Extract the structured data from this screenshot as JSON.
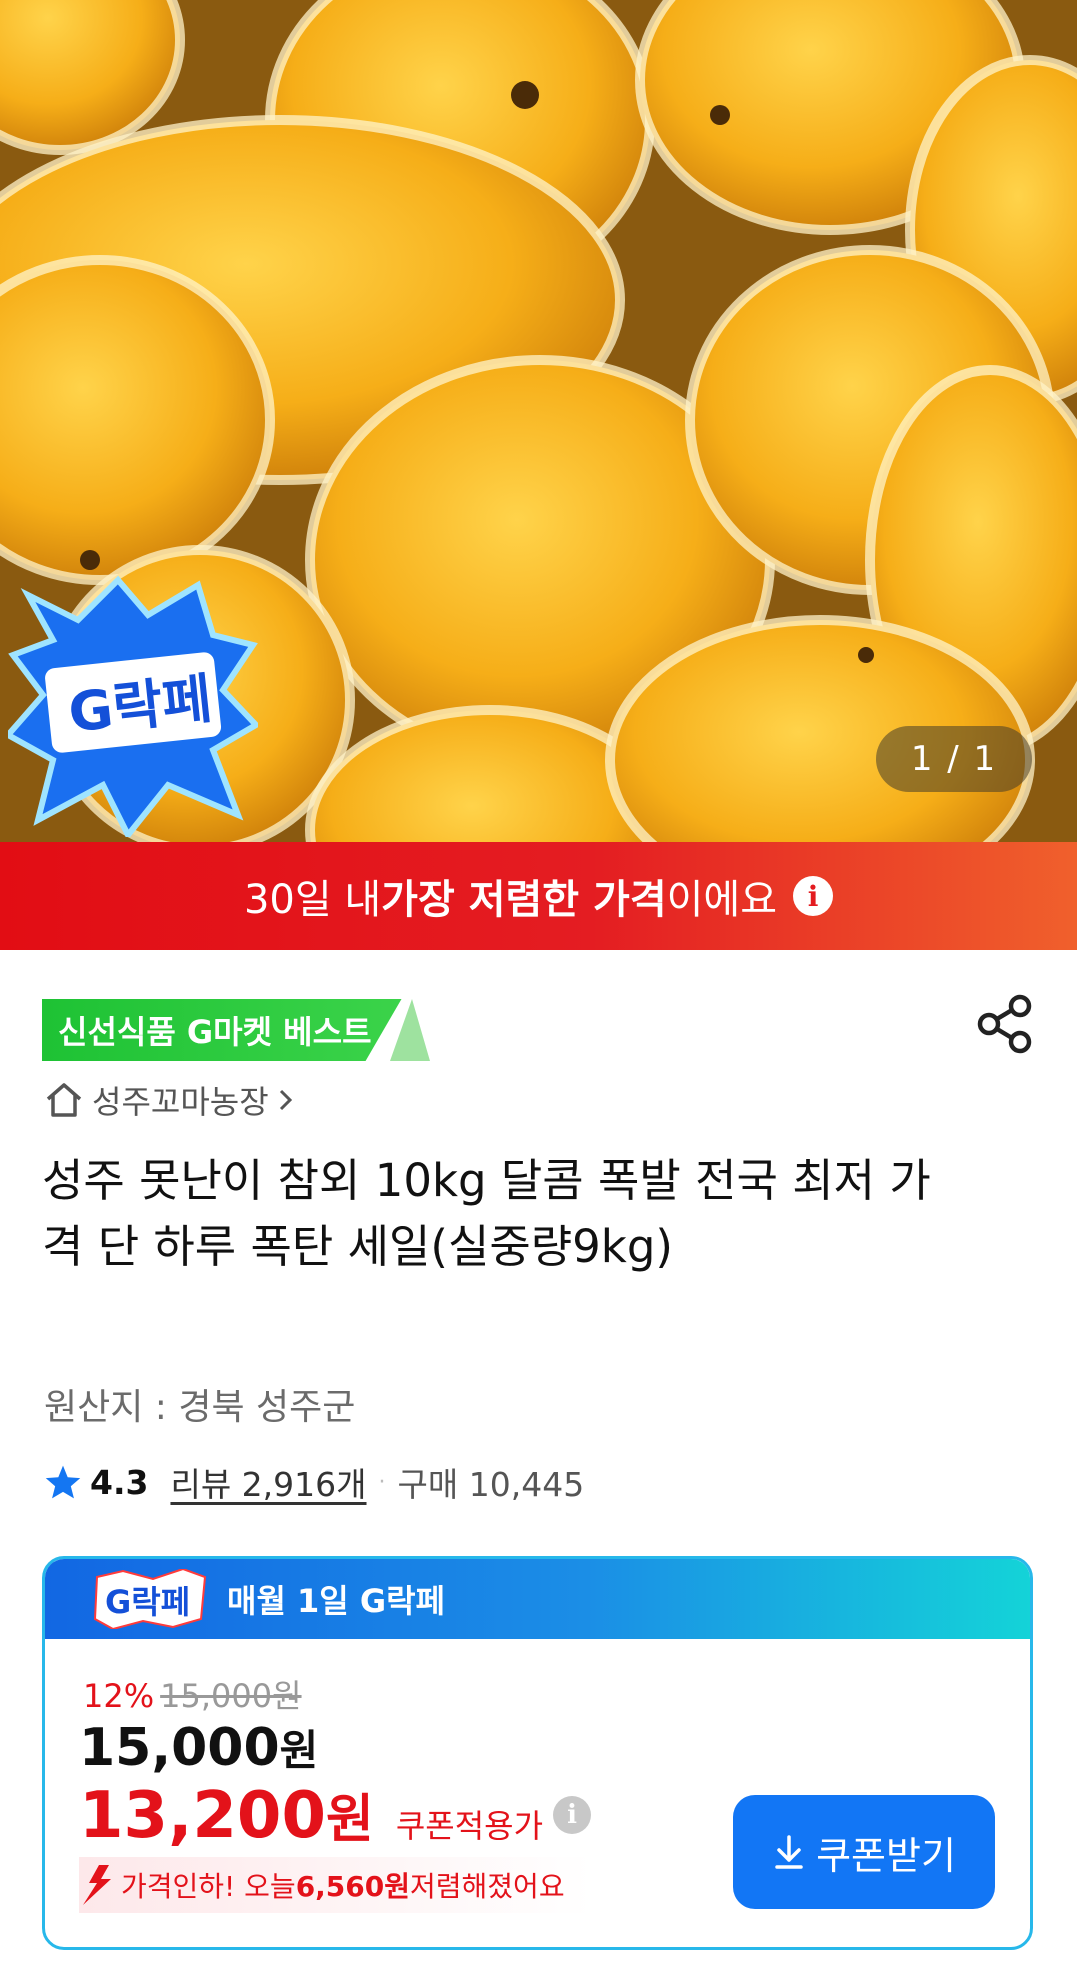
{
  "gallery": {
    "page_indicator": "1 / 1",
    "badge_text": "G락페"
  },
  "banner": {
    "prefix": "30일 내 ",
    "highlight": "가장 저렴한 가격",
    "suffix": "이에요",
    "info_glyph": "i"
  },
  "product": {
    "best_tag": "신선식품 G마켓 베스트",
    "store_name": "성주꼬마농장",
    "title": "성주 못난이 참외 10kg 달콤 폭발 전국 최저 가격 단 하루 폭탄 세일(실중량9kg)",
    "origin": "원산지 : 경북 성주군",
    "rating": "4.3",
    "review_count": "리뷰 2,916개",
    "separator": "·",
    "purchase_count": "구매 10,445"
  },
  "price_card": {
    "logo_text": "G락페",
    "header_label": "매월 1일 G락페",
    "discount_rate": "12%",
    "original_price": "15,000원",
    "base_price": "15,000",
    "base_price_unit": "원",
    "coupon_price": "13,200",
    "coupon_price_unit": "원",
    "coupon_label": "쿠폰적용가",
    "info_glyph": "i",
    "drop_prefix": "가격인하! 오늘 ",
    "drop_amount": "6,560원",
    "drop_suffix": " 저렴해졌어요",
    "coupon_button": "쿠폰받기"
  },
  "icons": {
    "share": "share-icon",
    "home": "home-icon",
    "chevron": "chevron-right-icon",
    "star": "star-icon",
    "info": "info-icon",
    "arrow_down": "download-arrow-icon",
    "price_drop": "price-drop-arrow-icon"
  },
  "colors": {
    "banner_red": "#e20d14",
    "best_green": "#1ec234",
    "card_blue": "#1267e3",
    "card_cyan": "#14d3d8",
    "price_red": "#e3121a",
    "button_blue": "#1276f5",
    "star_blue": "#1476f2"
  }
}
